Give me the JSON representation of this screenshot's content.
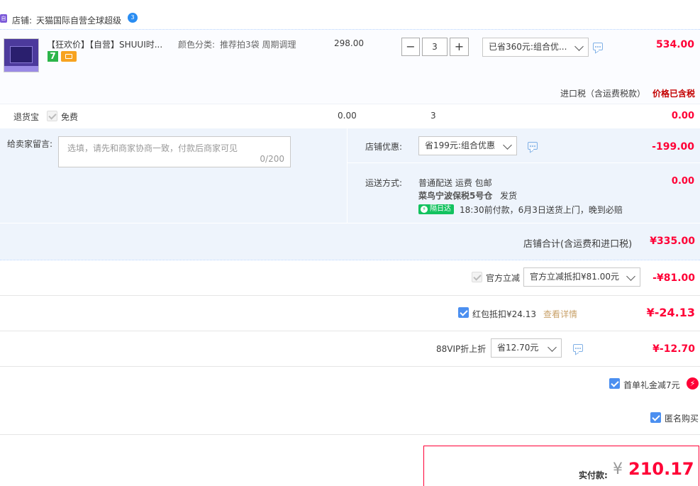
{
  "shop": {
    "label": "店铺:",
    "name": "天猫国际自营全球超级",
    "ww_badge": "3"
  },
  "item": {
    "title": "【狂欢价】【自营】SHUUI时...",
    "sku_label": "颜色分类:",
    "sku_value": "推荐拍3袋 周期调理",
    "unit_price": "298.00",
    "quantity": "3",
    "minus": "−",
    "plus": "+",
    "promo_select": "已省360元:组合优...",
    "subtotal": "534.00",
    "badge_7": "7"
  },
  "tax": {
    "label": "进口税（含运费税款）",
    "value": "价格已含税"
  },
  "return_insurance": {
    "label": "退货宝",
    "free": "免费",
    "price": "0.00",
    "qty": "3",
    "total": "0.00"
  },
  "message": {
    "label": "给卖家留言:",
    "placeholder": "选填，请先和商家协商一致，付款后商家可见",
    "counter": "0/200"
  },
  "shop_discount": {
    "label": "店铺优惠:",
    "select": "省199元:组合优惠",
    "value": "-199.00"
  },
  "shipping": {
    "label": "运送方式:",
    "method": "普通配送 运费 包邮",
    "warehouse": "菜鸟宁波保税5号仓",
    "ship": "发货",
    "badge": "隔日达",
    "promise": "18:30前付款，6月3日送货上门，晚到必赔",
    "value": "0.00"
  },
  "shop_total": {
    "label": "店铺合计(含运费和进口税)",
    "value": "¥335.00"
  },
  "official": {
    "label": "官方立减",
    "select": "官方立减抵扣¥81.00元",
    "value": "-¥81.00"
  },
  "redpacket": {
    "label": "红包抵扣¥24.13",
    "link": "查看详情",
    "value": "¥-24.13"
  },
  "vip": {
    "label": "88VIP折上折",
    "select": "省12.70元",
    "value": "¥-12.70"
  },
  "first_order": {
    "label": "首单礼金减7元"
  },
  "anonymous": {
    "label": "匿名购买"
  },
  "pay": {
    "label": "实付款:",
    "currency": "¥",
    "amount": "210.17"
  },
  "colors": {
    "accent_red": "#ff0036",
    "blue_bg": "#eef4fc",
    "checkbox_blue": "#4b8ff0"
  }
}
